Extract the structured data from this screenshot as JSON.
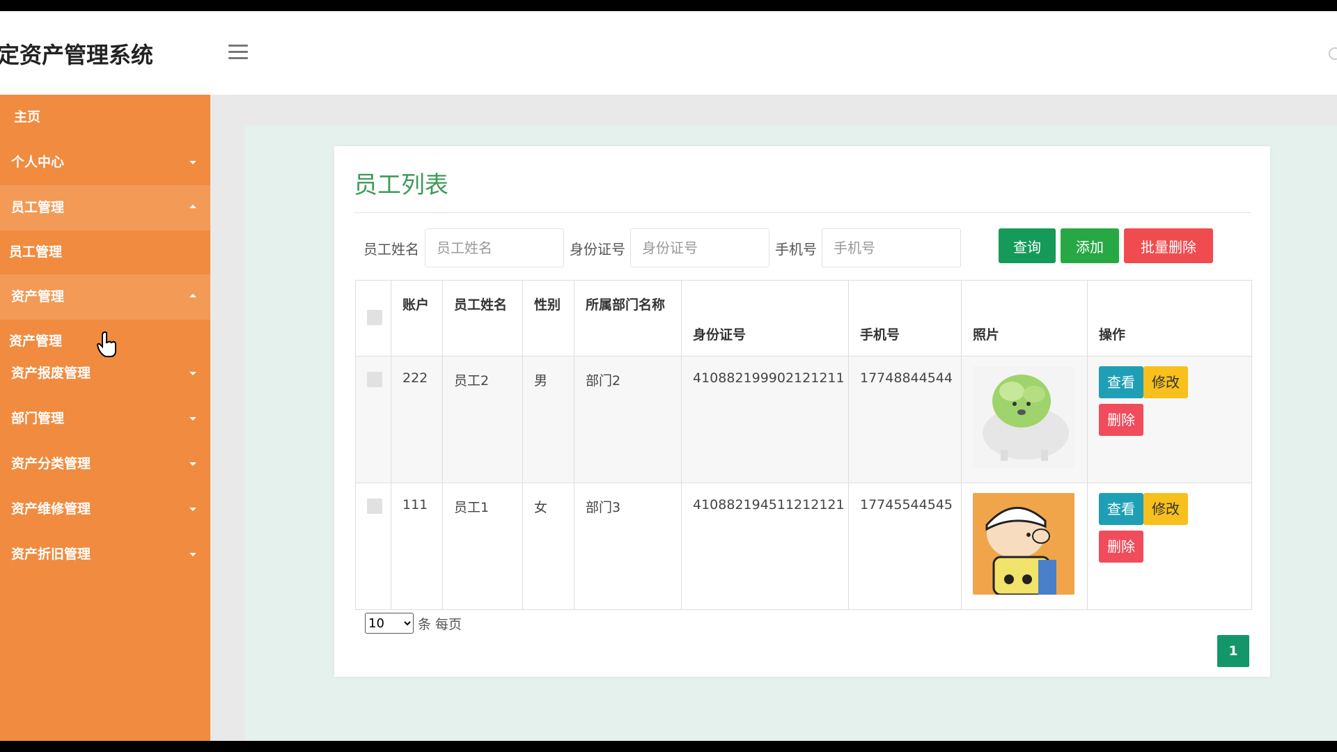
{
  "header": {
    "title": "定资产管理系统"
  },
  "sidebar": {
    "home": "主页",
    "items": [
      {
        "label": "个人中心"
      },
      {
        "label": "员工管理",
        "sub": "员工管理"
      },
      {
        "label": "资产管理",
        "sub": "资产管理"
      },
      {
        "label": "资产报废管理"
      },
      {
        "label": "部门管理"
      },
      {
        "label": "资产分类管理"
      },
      {
        "label": "资产维修管理"
      },
      {
        "label": "资产折旧管理"
      }
    ]
  },
  "main": {
    "card_title": "员工列表",
    "search": {
      "name_label": "员工姓名",
      "name_placeholder": "员工姓名",
      "id_label": "身份证号",
      "id_placeholder": "身份证号",
      "phone_label": "手机号",
      "phone_placeholder": "手机号"
    },
    "buttons": {
      "query": "查询",
      "add": "添加",
      "batch_delete": "批量删除"
    },
    "table": {
      "columns": [
        "账户",
        "员工姓名",
        "性别",
        "所属部门名称",
        "身份证号",
        "手机号",
        "照片",
        "操作"
      ],
      "rows": [
        {
          "account": "222",
          "name": "员工2",
          "gender": "男",
          "dept": "部门2",
          "id_no": "410882199902121211",
          "phone": "17748844544"
        },
        {
          "account": "111",
          "name": "员工1",
          "gender": "女",
          "dept": "部门3",
          "id_no": "410882194511212121",
          "phone": "17745544545"
        }
      ],
      "actions": {
        "view": "查看",
        "edit": "修改",
        "delete": "删除"
      }
    },
    "pagination": {
      "page_size": "10",
      "per_page_label": "条 每页",
      "current_page": "1"
    }
  },
  "colors": {
    "sidebar": "#f08b3f",
    "accent": "#3f9a5a",
    "query": "#169a59",
    "add": "#27a844",
    "danger": "#f04c4f",
    "view": "#1e9fb6",
    "edit": "#f7c01c"
  }
}
